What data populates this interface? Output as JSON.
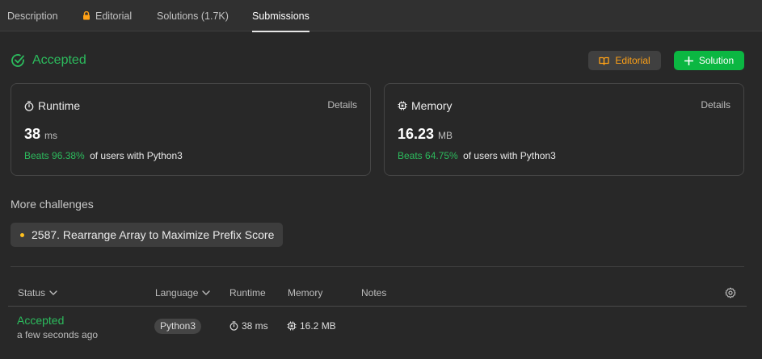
{
  "tabs": [
    {
      "label": "Description"
    },
    {
      "label": "Editorial",
      "icon": "lock-icon"
    },
    {
      "label": "Solutions (1.7K)"
    },
    {
      "label": "Submissions",
      "active": true
    }
  ],
  "result": {
    "status": "Accepted",
    "editorial_button": "Editorial",
    "solution_button": "Solution"
  },
  "runtime_card": {
    "title": "Runtime",
    "details": "Details",
    "value": "38",
    "unit": "ms",
    "beats": "Beats 96.38%",
    "suffix": "of users with Python3"
  },
  "memory_card": {
    "title": "Memory",
    "details": "Details",
    "value": "16.23",
    "unit": "MB",
    "beats": "Beats 64.75%",
    "suffix": "of users with Python3"
  },
  "more_challenges": {
    "title": "More challenges",
    "items": [
      {
        "label": "2587. Rearrange Array to Maximize Prefix Score"
      }
    ]
  },
  "table": {
    "headers": {
      "status": "Status",
      "language": "Language",
      "runtime": "Runtime",
      "memory": "Memory",
      "notes": "Notes"
    },
    "rows": [
      {
        "status": "Accepted",
        "time": "a few seconds ago",
        "language": "Python3",
        "runtime": "38 ms",
        "memory": "16.2 MB"
      }
    ]
  },
  "colors": {
    "accent_green": "#2cbb5d",
    "button_green": "#0bb742",
    "editorial_orange": "#ffa116",
    "background": "#282828"
  }
}
